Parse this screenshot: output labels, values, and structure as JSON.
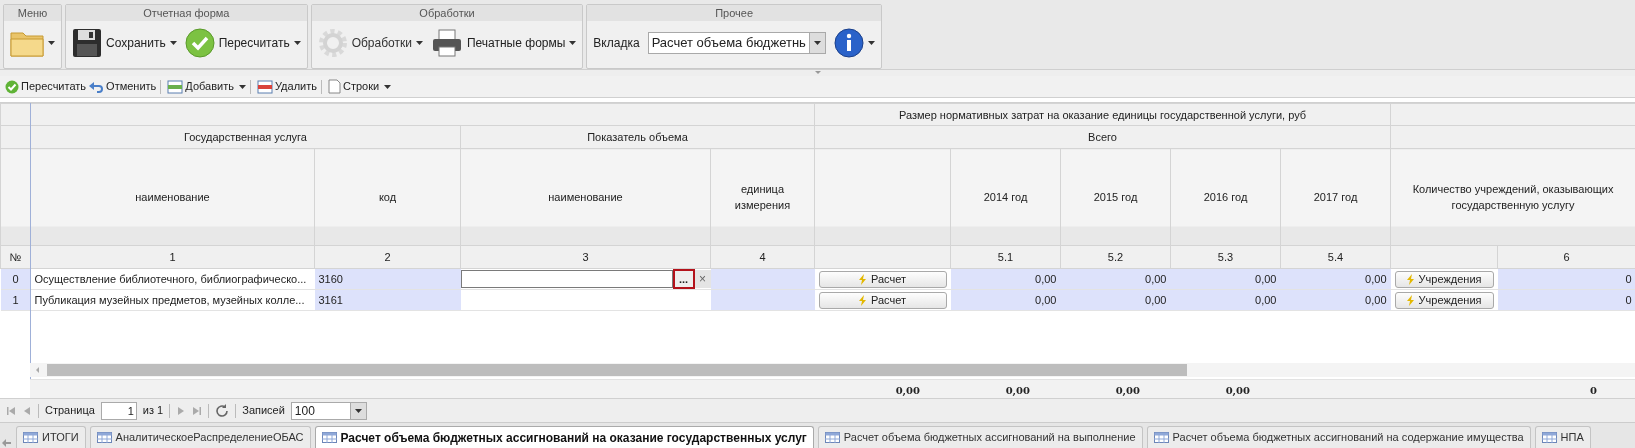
{
  "ribbon": {
    "groups": [
      {
        "title": "Меню",
        "items": [
          {
            "kind": "folder",
            "dropdown": true
          }
        ]
      },
      {
        "title": "Отчетная форма",
        "items": [
          {
            "kind": "save",
            "label": "Сохранить",
            "dropdown": true
          },
          {
            "kind": "check",
            "label": "Пересчитать",
            "dropdown": true
          }
        ]
      },
      {
        "title": "Обработки",
        "items": [
          {
            "kind": "gear",
            "label": "Обработки",
            "dropdown": true,
            "disabled": true
          },
          {
            "kind": "printer",
            "label": "Печатные формы",
            "dropdown": true
          }
        ]
      },
      {
        "title": "Прочее",
        "items": [
          {
            "kind": "select",
            "label": "Вкладка",
            "value": "Расчет объема бюджетнь"
          },
          {
            "kind": "info",
            "dropdown": true
          }
        ]
      }
    ]
  },
  "toolbar": [
    {
      "kind": "check",
      "label": "Пересчитать",
      "dropdown": false
    },
    {
      "kind": "undo",
      "label": "Отменить",
      "dropdown": false
    },
    {
      "kind": "add",
      "label": "Добавить",
      "dropdown": true
    },
    {
      "kind": "delete",
      "label": "Удалить",
      "dropdown": false
    },
    {
      "kind": "rows",
      "label": "Строки",
      "dropdown": true
    }
  ],
  "table": {
    "header": {
      "costs": "Размер нормативных затрат на оказание единицы государственной услуги, руб",
      "service": "Государственная услуга",
      "indicator": "Показатель объема",
      "total": "Всего",
      "columns": [
        "наименование",
        "код",
        "наименование",
        "единица измерения",
        "2014 год",
        "2015 год",
        "2016 год",
        "2017 год",
        "Количество учреждений, оказывающих государственную услугу"
      ],
      "numbers": [
        "№",
        "1",
        "2",
        "3",
        "4",
        "5.1",
        "5.2",
        "5.3",
        "5.4",
        "6"
      ]
    },
    "rows": [
      {
        "number": "0",
        "name": "Осуществление библиотечного, библиографическо...",
        "code": "3160",
        "editing": true,
        "editor_button": "...",
        "clear_button": "×",
        "calc_button": "Расчет",
        "values": [
          "0,00",
          "0,00",
          "0,00",
          "0,00"
        ],
        "institutions_button": "Учреждения",
        "count": "0"
      },
      {
        "number": "1",
        "name": "Публикация музейных предметов, музейных колле...",
        "code": "3161",
        "editing": false,
        "calc_button": "Расчет",
        "values": [
          "0,00",
          "0,00",
          "0,00",
          "0,00"
        ],
        "institutions_button": "Учреждения",
        "count": "0"
      }
    ],
    "totals": [
      "0,00",
      "0,00",
      "0,00",
      "0,00",
      "0"
    ]
  },
  "pager": {
    "page_label": "Страница",
    "page": "1",
    "of": "из 1",
    "records_label": "Записей",
    "records": "100"
  },
  "tabs": [
    {
      "label": "ИТОГИ",
      "selected": false
    },
    {
      "label": "АналитическоеРаспределениеОБАС",
      "selected": false
    },
    {
      "label": "Расчет объема бюджетных ассигнований на оказание государственных услуг",
      "selected": true
    },
    {
      "label": "Расчет объема бюджетных ассигнований на выполнение",
      "selected": false
    },
    {
      "label": "Расчет объема бюджетных ассигнований на содержание имущества",
      "selected": false
    },
    {
      "label": "НПА",
      "selected": false
    }
  ]
}
